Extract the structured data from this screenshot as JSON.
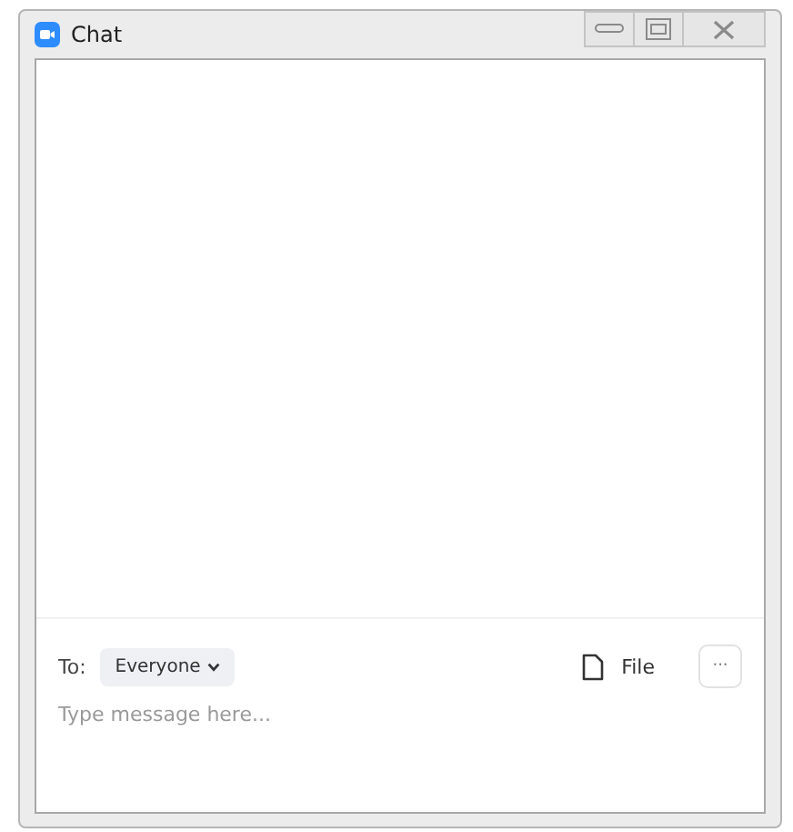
{
  "window": {
    "title": "Chat"
  },
  "composer": {
    "to_label": "To:",
    "recipient": "Everyone",
    "file_label": "File",
    "more": "···",
    "placeholder": "Type message here..."
  }
}
